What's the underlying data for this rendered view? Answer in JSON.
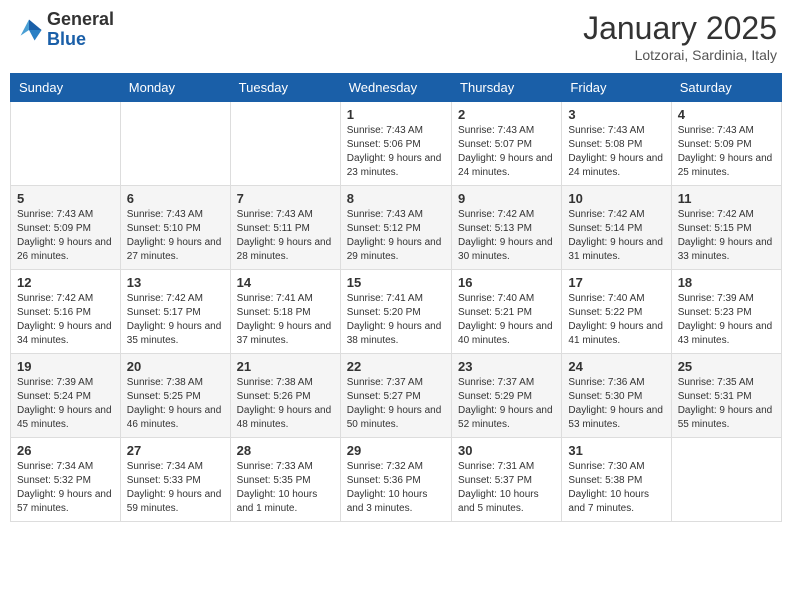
{
  "logo": {
    "general": "General",
    "blue": "Blue"
  },
  "header": {
    "month": "January 2025",
    "location": "Lotzorai, Sardinia, Italy"
  },
  "weekdays": [
    "Sunday",
    "Monday",
    "Tuesday",
    "Wednesday",
    "Thursday",
    "Friday",
    "Saturday"
  ],
  "weeks": [
    [
      {
        "day": "",
        "sunrise": "",
        "sunset": "",
        "daylight": ""
      },
      {
        "day": "",
        "sunrise": "",
        "sunset": "",
        "daylight": ""
      },
      {
        "day": "",
        "sunrise": "",
        "sunset": "",
        "daylight": ""
      },
      {
        "day": "1",
        "sunrise": "Sunrise: 7:43 AM",
        "sunset": "Sunset: 5:06 PM",
        "daylight": "Daylight: 9 hours and 23 minutes."
      },
      {
        "day": "2",
        "sunrise": "Sunrise: 7:43 AM",
        "sunset": "Sunset: 5:07 PM",
        "daylight": "Daylight: 9 hours and 24 minutes."
      },
      {
        "day": "3",
        "sunrise": "Sunrise: 7:43 AM",
        "sunset": "Sunset: 5:08 PM",
        "daylight": "Daylight: 9 hours and 24 minutes."
      },
      {
        "day": "4",
        "sunrise": "Sunrise: 7:43 AM",
        "sunset": "Sunset: 5:09 PM",
        "daylight": "Daylight: 9 hours and 25 minutes."
      }
    ],
    [
      {
        "day": "5",
        "sunrise": "Sunrise: 7:43 AM",
        "sunset": "Sunset: 5:09 PM",
        "daylight": "Daylight: 9 hours and 26 minutes."
      },
      {
        "day": "6",
        "sunrise": "Sunrise: 7:43 AM",
        "sunset": "Sunset: 5:10 PM",
        "daylight": "Daylight: 9 hours and 27 minutes."
      },
      {
        "day": "7",
        "sunrise": "Sunrise: 7:43 AM",
        "sunset": "Sunset: 5:11 PM",
        "daylight": "Daylight: 9 hours and 28 minutes."
      },
      {
        "day": "8",
        "sunrise": "Sunrise: 7:43 AM",
        "sunset": "Sunset: 5:12 PM",
        "daylight": "Daylight: 9 hours and 29 minutes."
      },
      {
        "day": "9",
        "sunrise": "Sunrise: 7:42 AM",
        "sunset": "Sunset: 5:13 PM",
        "daylight": "Daylight: 9 hours and 30 minutes."
      },
      {
        "day": "10",
        "sunrise": "Sunrise: 7:42 AM",
        "sunset": "Sunset: 5:14 PM",
        "daylight": "Daylight: 9 hours and 31 minutes."
      },
      {
        "day": "11",
        "sunrise": "Sunrise: 7:42 AM",
        "sunset": "Sunset: 5:15 PM",
        "daylight": "Daylight: 9 hours and 33 minutes."
      }
    ],
    [
      {
        "day": "12",
        "sunrise": "Sunrise: 7:42 AM",
        "sunset": "Sunset: 5:16 PM",
        "daylight": "Daylight: 9 hours and 34 minutes."
      },
      {
        "day": "13",
        "sunrise": "Sunrise: 7:42 AM",
        "sunset": "Sunset: 5:17 PM",
        "daylight": "Daylight: 9 hours and 35 minutes."
      },
      {
        "day": "14",
        "sunrise": "Sunrise: 7:41 AM",
        "sunset": "Sunset: 5:18 PM",
        "daylight": "Daylight: 9 hours and 37 minutes."
      },
      {
        "day": "15",
        "sunrise": "Sunrise: 7:41 AM",
        "sunset": "Sunset: 5:20 PM",
        "daylight": "Daylight: 9 hours and 38 minutes."
      },
      {
        "day": "16",
        "sunrise": "Sunrise: 7:40 AM",
        "sunset": "Sunset: 5:21 PM",
        "daylight": "Daylight: 9 hours and 40 minutes."
      },
      {
        "day": "17",
        "sunrise": "Sunrise: 7:40 AM",
        "sunset": "Sunset: 5:22 PM",
        "daylight": "Daylight: 9 hours and 41 minutes."
      },
      {
        "day": "18",
        "sunrise": "Sunrise: 7:39 AM",
        "sunset": "Sunset: 5:23 PM",
        "daylight": "Daylight: 9 hours and 43 minutes."
      }
    ],
    [
      {
        "day": "19",
        "sunrise": "Sunrise: 7:39 AM",
        "sunset": "Sunset: 5:24 PM",
        "daylight": "Daylight: 9 hours and 45 minutes."
      },
      {
        "day": "20",
        "sunrise": "Sunrise: 7:38 AM",
        "sunset": "Sunset: 5:25 PM",
        "daylight": "Daylight: 9 hours and 46 minutes."
      },
      {
        "day": "21",
        "sunrise": "Sunrise: 7:38 AM",
        "sunset": "Sunset: 5:26 PM",
        "daylight": "Daylight: 9 hours and 48 minutes."
      },
      {
        "day": "22",
        "sunrise": "Sunrise: 7:37 AM",
        "sunset": "Sunset: 5:27 PM",
        "daylight": "Daylight: 9 hours and 50 minutes."
      },
      {
        "day": "23",
        "sunrise": "Sunrise: 7:37 AM",
        "sunset": "Sunset: 5:29 PM",
        "daylight": "Daylight: 9 hours and 52 minutes."
      },
      {
        "day": "24",
        "sunrise": "Sunrise: 7:36 AM",
        "sunset": "Sunset: 5:30 PM",
        "daylight": "Daylight: 9 hours and 53 minutes."
      },
      {
        "day": "25",
        "sunrise": "Sunrise: 7:35 AM",
        "sunset": "Sunset: 5:31 PM",
        "daylight": "Daylight: 9 hours and 55 minutes."
      }
    ],
    [
      {
        "day": "26",
        "sunrise": "Sunrise: 7:34 AM",
        "sunset": "Sunset: 5:32 PM",
        "daylight": "Daylight: 9 hours and 57 minutes."
      },
      {
        "day": "27",
        "sunrise": "Sunrise: 7:34 AM",
        "sunset": "Sunset: 5:33 PM",
        "daylight": "Daylight: 9 hours and 59 minutes."
      },
      {
        "day": "28",
        "sunrise": "Sunrise: 7:33 AM",
        "sunset": "Sunset: 5:35 PM",
        "daylight": "Daylight: 10 hours and 1 minute."
      },
      {
        "day": "29",
        "sunrise": "Sunrise: 7:32 AM",
        "sunset": "Sunset: 5:36 PM",
        "daylight": "Daylight: 10 hours and 3 minutes."
      },
      {
        "day": "30",
        "sunrise": "Sunrise: 7:31 AM",
        "sunset": "Sunset: 5:37 PM",
        "daylight": "Daylight: 10 hours and 5 minutes."
      },
      {
        "day": "31",
        "sunrise": "Sunrise: 7:30 AM",
        "sunset": "Sunset: 5:38 PM",
        "daylight": "Daylight: 10 hours and 7 minutes."
      },
      {
        "day": "",
        "sunrise": "",
        "sunset": "",
        "daylight": ""
      }
    ]
  ]
}
